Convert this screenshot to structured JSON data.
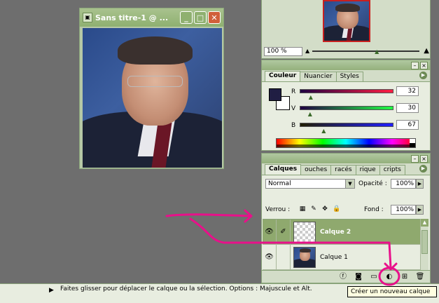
{
  "document_window": {
    "title": "Sans titre-1 @ ...",
    "icon": "document-icon",
    "buttons": [
      "minimize-icon",
      "maximize-icon",
      "close-icon"
    ]
  },
  "navigator": {
    "zoom": "100 %"
  },
  "color_panel": {
    "tabs": [
      "Couleur",
      "Nuancier",
      "Styles"
    ],
    "active_tab": "Couleur",
    "foreground": "#201E43",
    "background": "#FFFFFF",
    "channels": [
      {
        "label": "R",
        "value": "32",
        "fraction": 0.125
      },
      {
        "label": "V",
        "value": "30",
        "fraction": 0.118
      },
      {
        "label": "B",
        "value": "67",
        "fraction": 0.263
      }
    ]
  },
  "layers_panel": {
    "tabs": [
      "Calques",
      "ouches",
      "racés",
      "rique",
      "cripts"
    ],
    "active_tab": "Calques",
    "blend_mode": "Normal",
    "opacity_label": "Opacité :",
    "opacity_value": "100%",
    "lock_label": "Verrou :",
    "fill_label": "Fond :",
    "fill_value": "100%",
    "layers": [
      {
        "name": "Calque 2",
        "selected": true,
        "transparent": true
      },
      {
        "name": "Calque 1",
        "selected": false,
        "transparent": false
      }
    ]
  },
  "status_bar": {
    "message": "Faites glisser pour déplacer le calque ou la sélection. Options : Majuscule et Alt."
  },
  "tooltip": {
    "text": "Créer un nouveau calque"
  },
  "annotation": {
    "color": "#E8108A"
  }
}
